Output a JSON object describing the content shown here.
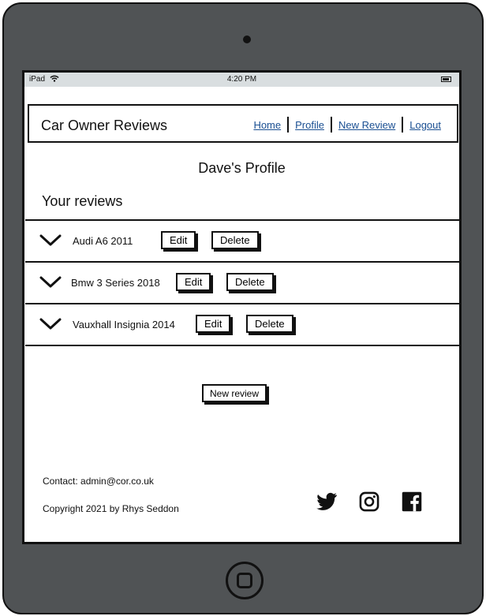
{
  "status": {
    "carrier": "iPad",
    "time": "4:20 PM"
  },
  "header": {
    "brand": "Car Owner Reviews",
    "nav": [
      "Home",
      "Profile",
      "New Review",
      "Logout"
    ]
  },
  "profile_title": "Dave's Profile",
  "section_title": "Your reviews",
  "reviews": [
    {
      "car": "Audi A6 2011",
      "edit": "Edit",
      "delete": "Delete"
    },
    {
      "car": "Bmw 3 Series 2018",
      "edit": "Edit",
      "delete": "Delete"
    },
    {
      "car": "Vauxhall Insignia 2014",
      "edit": "Edit",
      "delete": "Delete"
    }
  ],
  "new_review_label": "New review",
  "footer": {
    "contact": "Contact: admin@cor.co.uk",
    "copyright": "Copyright 2021 by Rhys Seddon",
    "social_icons": [
      "twitter-icon",
      "instagram-icon",
      "facebook-icon"
    ]
  },
  "colors": {
    "link": "#1a4f92",
    "frame": "#505355",
    "status_bar": "#d9dee0"
  }
}
